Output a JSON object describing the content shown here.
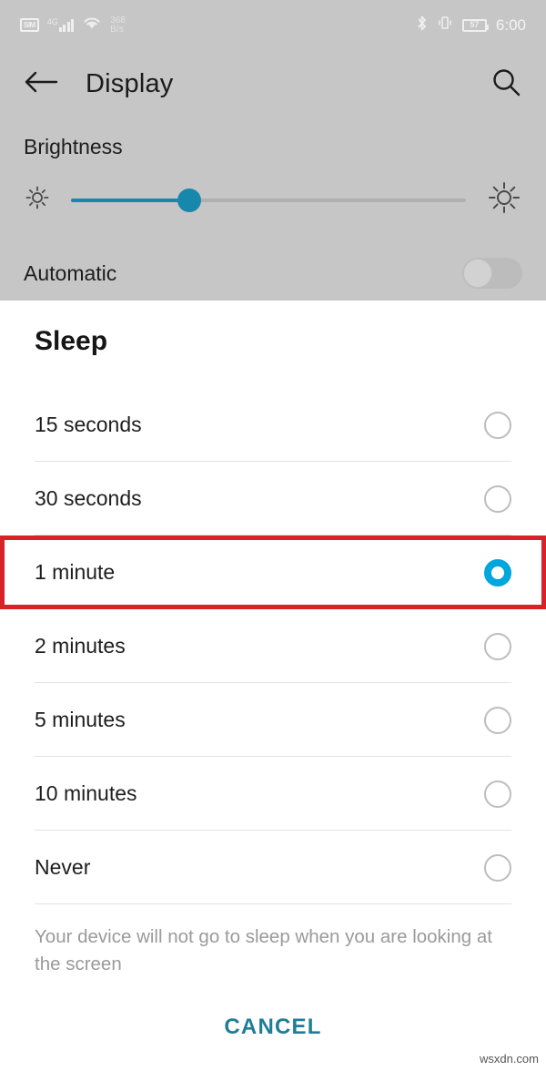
{
  "status_bar": {
    "sim_label": "SIM",
    "network_type": "4G",
    "signal_bars": 4,
    "wifi_icon": "wifi-icon",
    "data_rate_value": "368",
    "data_rate_unit": "B/s",
    "bluetooth_icon": "bluetooth-icon",
    "vibrate_icon": "vibrate-icon",
    "battery_percent": "57",
    "time": "6:00"
  },
  "app_bar": {
    "back_icon": "back-arrow-icon",
    "title": "Display",
    "search_icon": "search-icon"
  },
  "settings": {
    "brightness_label": "Brightness",
    "brightness_value_percent": 30,
    "low_brightness_icon": "brightness-low-icon",
    "high_brightness_icon": "brightness-high-icon",
    "automatic_label": "Automatic",
    "automatic_enabled": false
  },
  "dialog": {
    "title": "Sleep",
    "selected_option": "1 minute",
    "options": [
      {
        "label": "15 seconds",
        "selected": false
      },
      {
        "label": "30 seconds",
        "selected": false
      },
      {
        "label": "1 minute",
        "selected": true
      },
      {
        "label": "2 minutes",
        "selected": false
      },
      {
        "label": "5 minutes",
        "selected": false
      },
      {
        "label": "10 minutes",
        "selected": false
      },
      {
        "label": "Never",
        "selected": false
      }
    ],
    "footnote": "Your device will not go to sleep when you are looking at the screen",
    "cancel_label": "CANCEL"
  },
  "annotation": {
    "highlight_color": "#d82128",
    "highlighted_option": "1 minute"
  },
  "watermark": "wsxdn.com",
  "colors": {
    "chrome_gray": "#c6c6c6",
    "accent_teal": "#1787ab",
    "radio_selected": "#00a6dd",
    "cancel_text": "#1f7d98",
    "highlight_red": "#d82128"
  }
}
